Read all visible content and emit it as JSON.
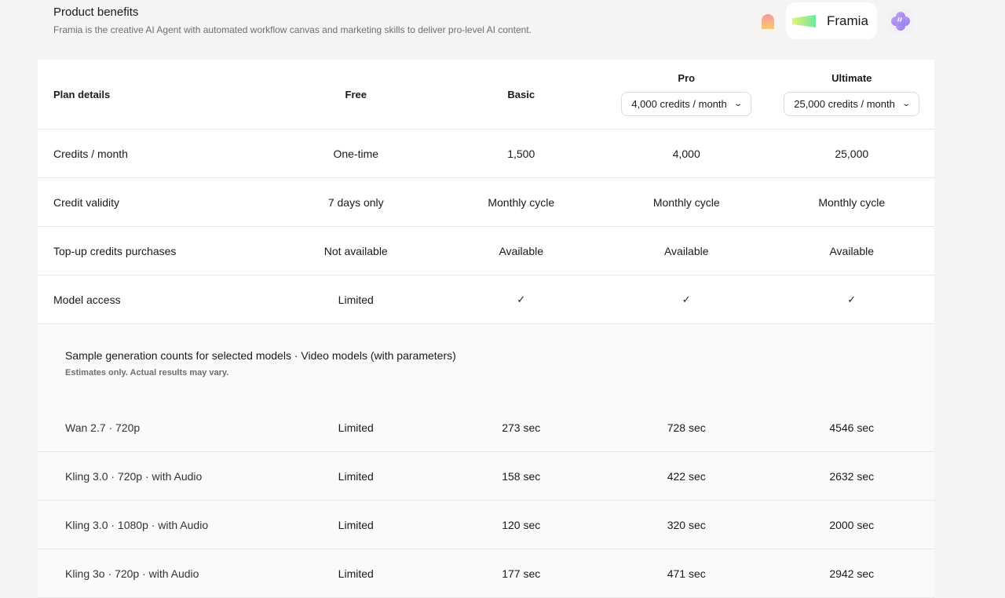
{
  "header": {
    "title": "Product benefits",
    "subtitle": "Framia is the creative AI Agent with automated workflow canvas and marketing skills to deliver pro-level AI content."
  },
  "logos": {
    "main_label": "Framia"
  },
  "table": {
    "head": {
      "label": "Plan details",
      "free": "Free",
      "basic": "Basic",
      "pro": "Pro",
      "pro_credits": "4,000 credits / month",
      "ultimate": "Ultimate",
      "ultimate_credits": "25,000 credits / month"
    },
    "rows": [
      {
        "label": "Credits / month",
        "free": "One-time",
        "basic": "1,500",
        "pro": "4,000",
        "ultimate": "25,000"
      },
      {
        "label": "Credit validity",
        "free": "7 days only",
        "basic": "Monthly cycle",
        "pro": "Monthly cycle",
        "ultimate": "Monthly cycle"
      },
      {
        "label": "Top-up credits purchases",
        "free": "Not available",
        "basic": "Available",
        "pro": "Available",
        "ultimate": "Available"
      },
      {
        "label": "Model access",
        "free": "Limited",
        "basic": "✓",
        "pro": "✓",
        "ultimate": "✓"
      }
    ],
    "section": {
      "title": "Sample generation counts for selected models · Video models (with parameters)",
      "note": "Estimates only. Actual results may vary."
    },
    "model_rows": [
      {
        "label": "Wan 2.7 · 720p",
        "free": "Limited",
        "basic": "273 sec",
        "pro": "728 sec",
        "ultimate": "4546 sec"
      },
      {
        "label": "Kling 3.0 · 720p · with Audio",
        "free": "Limited",
        "basic": "158 sec",
        "pro": "422 sec",
        "ultimate": "2632 sec"
      },
      {
        "label": "Kling 3.0 · 1080p · with Audio",
        "free": "Limited",
        "basic": "120 sec",
        "pro": "320 sec",
        "ultimate": "2000 sec"
      },
      {
        "label": "Kling 3o · 720p · with Audio",
        "free": "Limited",
        "basic": "177 sec",
        "pro": "471 sec",
        "ultimate": "2942 sec"
      }
    ]
  }
}
